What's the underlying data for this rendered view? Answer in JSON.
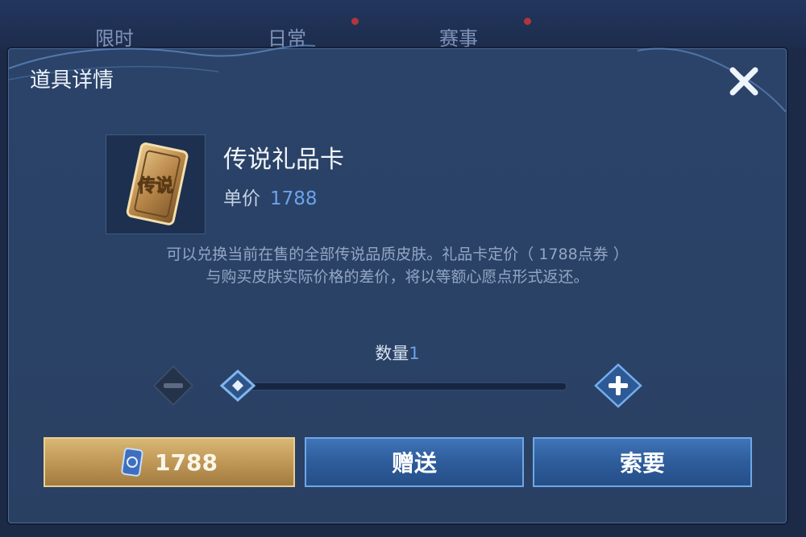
{
  "background_tabs": [
    {
      "label": "限时"
    },
    {
      "label": "日常"
    },
    {
      "label": "赛事"
    }
  ],
  "dialog": {
    "title": "道具详情",
    "close_icon": "close-icon"
  },
  "item": {
    "name": "传说礼品卡",
    "icon_text": "传说",
    "price_label": "单价",
    "price_value": "1788",
    "description_line1": "可以兑换当前在售的全部传说品质皮肤。礼品卡定价（ 1788点券 ）",
    "description_line2": "与购买皮肤实际价格的差价，将以等额心愿点形式返还。"
  },
  "quantity": {
    "label": "数量",
    "value": "1",
    "minus_icon": "minus-icon",
    "plus_icon": "plus-icon",
    "slider_level": 0
  },
  "buttons": {
    "buy_price": "1788",
    "gift_label": "赠送",
    "ask_label": "索要"
  },
  "colors": {
    "accent_blue": "#6ba3ea",
    "gold": "#c59d5c",
    "panel": "#2b4368"
  }
}
